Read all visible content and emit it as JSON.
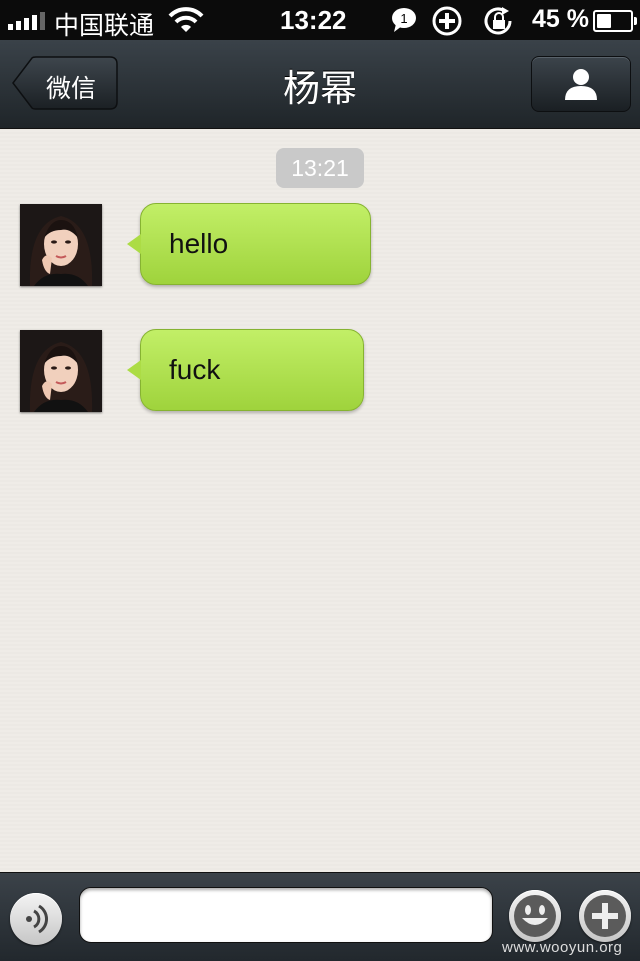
{
  "status_bar": {
    "carrier": "中国联通",
    "time": "13:22",
    "battery_percent": "45 %",
    "battery_level": 0.45,
    "signal_bars": 4,
    "icons": [
      "signal-icon",
      "wifi-icon",
      "chat-notification-icon",
      "add-circle-icon",
      "rotation-lock-icon",
      "battery-icon"
    ]
  },
  "nav": {
    "back_label": "微信",
    "title": "杨幂",
    "profile_icon": "person-icon"
  },
  "chat": {
    "timestamp": "13:21",
    "messages": [
      {
        "text": "hello",
        "sender": "contact"
      },
      {
        "text": "fuck",
        "sender": "contact"
      }
    ]
  },
  "input_bar": {
    "text_value": "",
    "left_icon": "voice-icon",
    "emoji_icon": "smiley-icon",
    "more_icon": "plus-icon"
  },
  "watermark": "www.wooyun.org",
  "colors": {
    "bubble": "#acdc45",
    "navbar": "#2c3338"
  }
}
